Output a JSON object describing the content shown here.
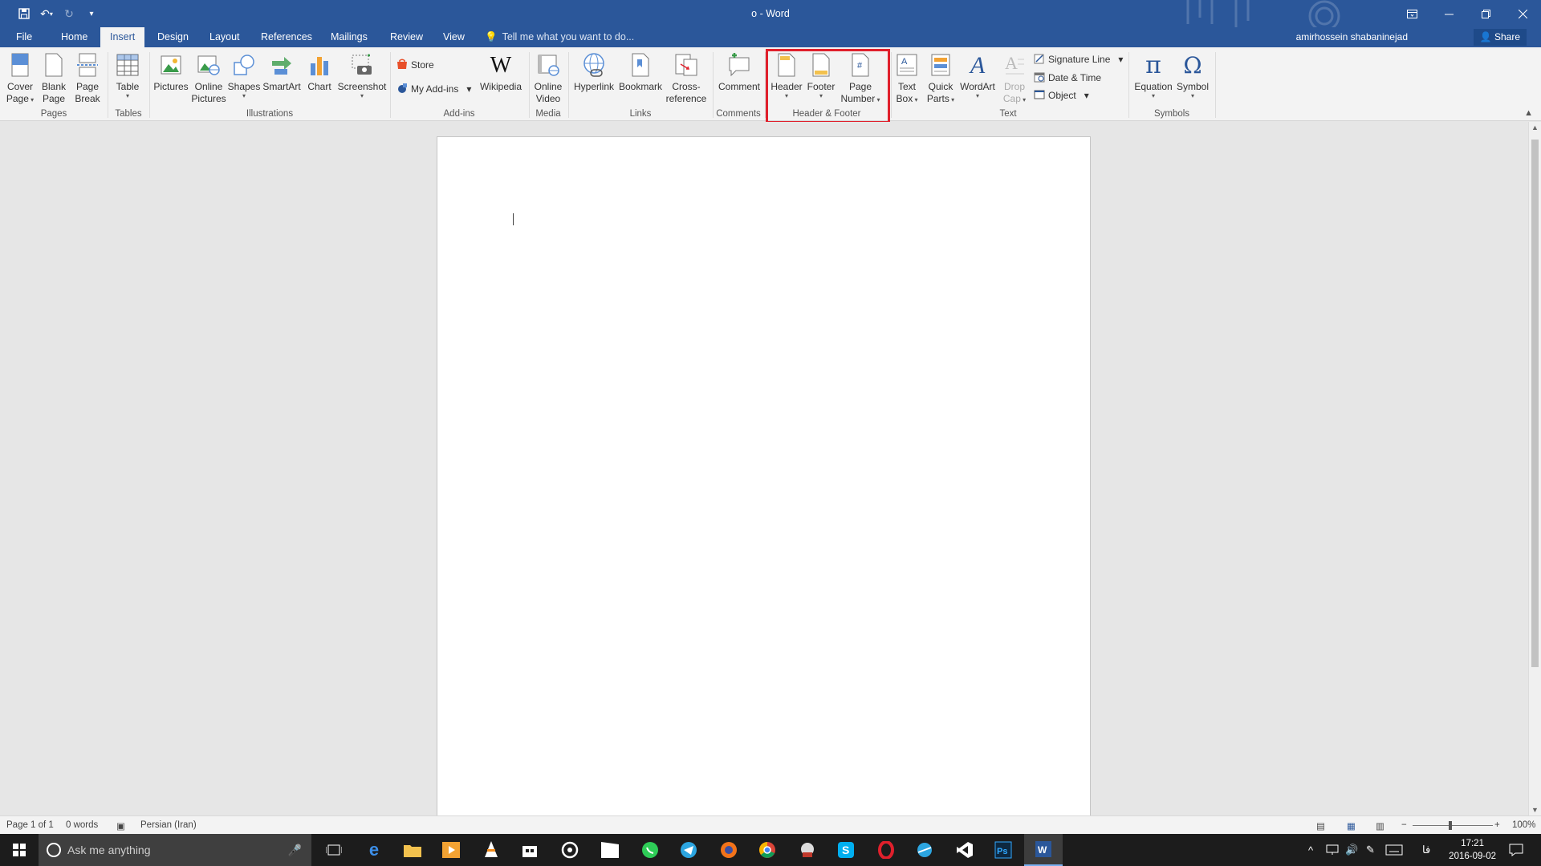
{
  "window": {
    "title": "o - Word",
    "user": "amirhossein shabaninejad",
    "share_label": "Share"
  },
  "tabs": [
    "File",
    "Home",
    "Insert",
    "Design",
    "Layout",
    "References",
    "Mailings",
    "Review",
    "View"
  ],
  "active_tab": "Insert",
  "tell_me": "Tell me what you want to do...",
  "ribbon": {
    "pages": {
      "label": "Pages",
      "cover": "Cover",
      "cover2": "Page",
      "blank": "Blank",
      "blank2": "Page",
      "break": "Page",
      "break2": "Break"
    },
    "tables": {
      "label": "Tables",
      "table": "Table"
    },
    "illustrations": {
      "label": "Illustrations",
      "pictures": "Pictures",
      "online": "Online",
      "online2": "Pictures",
      "shapes": "Shapes",
      "smartart": "SmartArt",
      "chart": "Chart",
      "screenshot": "Screenshot"
    },
    "addins": {
      "label": "Add-ins",
      "store": "Store",
      "myaddins": "My Add-ins",
      "wikipedia": "Wikipedia"
    },
    "media": {
      "label": "Media",
      "video": "Online",
      "video2": "Video"
    },
    "links": {
      "label": "Links",
      "hyperlink": "Hyperlink",
      "bookmark": "Bookmark",
      "cross": "Cross-",
      "cross2": "reference"
    },
    "comments": {
      "label": "Comments",
      "comment": "Comment"
    },
    "headerfooter": {
      "label": "Header & Footer",
      "header": "Header",
      "footer": "Footer",
      "pagenum": "Page",
      "pagenum2": "Number"
    },
    "text": {
      "label": "Text",
      "textbox": "Text",
      "textbox2": "Box",
      "quickparts": "Quick",
      "quickparts2": "Parts",
      "wordart": "WordArt",
      "dropcap": "Drop",
      "dropcap2": "Cap",
      "signature": "Signature Line",
      "datetime": "Date & Time",
      "object": "Object"
    },
    "symbols": {
      "label": "Symbols",
      "equation": "Equation",
      "symbol": "Symbol"
    }
  },
  "status": {
    "page": "Page 1 of 1",
    "words": "0 words",
    "language": "Persian (Iran)",
    "zoom": "100%",
    "zoom_level": 100
  },
  "taskbar": {
    "search_placeholder": "Ask me anything",
    "time": "17:21",
    "date": "2016-09-02",
    "lang": "فا"
  }
}
